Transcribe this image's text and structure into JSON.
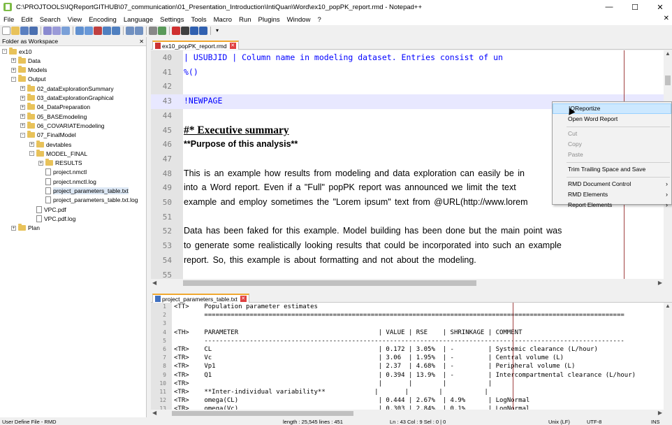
{
  "window": {
    "title": "C:\\PROJTOOLS\\IQReportGITHUB\\07_communication\\01_Presentation_Introduction\\IntiQuan\\Word\\ex10_popPK_report.rmd - Notepad++"
  },
  "menu": [
    "File",
    "Edit",
    "Search",
    "View",
    "Encoding",
    "Language",
    "Settings",
    "Tools",
    "Macro",
    "Run",
    "Plugins",
    "Window",
    "?"
  ],
  "left_panel": {
    "title": "Folder as Workspace",
    "tree": [
      {
        "label": "ex10",
        "icon": "folder-icon",
        "twist": "-"
      },
      {
        "label": "Data",
        "icon": "folder-icon",
        "twist": "+"
      },
      {
        "label": "Models",
        "icon": "folder-icon",
        "twist": "+"
      },
      {
        "label": "Output",
        "icon": "folder-icon",
        "twist": "-"
      },
      {
        "label": "02_dataExplorationSummary",
        "icon": "folder-icon",
        "twist": "+"
      },
      {
        "label": "03_dataExplorationGraphical",
        "icon": "folder-icon",
        "twist": "+"
      },
      {
        "label": "04_DataPreparation",
        "icon": "folder-icon",
        "twist": "+"
      },
      {
        "label": "05_BASEmodeling",
        "icon": "folder-icon",
        "twist": "+"
      },
      {
        "label": "06_COVARIATEmodeling",
        "icon": "folder-icon",
        "twist": "+"
      },
      {
        "label": "07_FinalModel",
        "icon": "folder-icon",
        "twist": "-"
      },
      {
        "label": "devtables",
        "icon": "folder-icon",
        "twist": "+"
      },
      {
        "label": "MODEL_FINAL",
        "icon": "folder-icon",
        "twist": "-"
      },
      {
        "label": "RESULTS",
        "icon": "folder-icon",
        "twist": "+"
      },
      {
        "label": "project.nmctl",
        "icon": "file-icon",
        "twist": ""
      },
      {
        "label": "project.nmctl.log",
        "icon": "file-icon",
        "twist": ""
      },
      {
        "label": "project_parameters_table.txt",
        "icon": "file-icon",
        "twist": ""
      },
      {
        "label": "project_parameters_table.txt.log",
        "icon": "file-icon",
        "twist": ""
      },
      {
        "label": "VPC.pdf",
        "icon": "file-icon",
        "twist": ""
      },
      {
        "label": "VPC.pdf.log",
        "icon": "file-icon",
        "twist": ""
      },
      {
        "label": "Plan",
        "icon": "folder-icon",
        "twist": "+"
      }
    ]
  },
  "editor1": {
    "tab": "ex10_popPK_report.rmd",
    "lines": [
      {
        "n": "40",
        "text": "| USUBJID                    | Column name in modeling dataset. Entries consist of un"
      },
      {
        "n": "41",
        "text": "%()"
      },
      {
        "n": "42",
        "text": ""
      },
      {
        "n": "43",
        "text": "!NEWPAGE"
      },
      {
        "n": "44",
        "text": ""
      },
      {
        "n": "45",
        "text": "#* Executive summary"
      },
      {
        "n": "46",
        "text": "**Purpose of this analysis**"
      },
      {
        "n": "47",
        "text": ""
      },
      {
        "n": "48",
        "text": "This is an example how results from modeling and data exploration can easily be in"
      },
      {
        "n": "49",
        "text": "into a Word report. Even if a \"Full\" popPK report was announced we limit the text"
      },
      {
        "n": "50",
        "text": "example and employ sometimes the \"Lorem ipsum\" text from @URL(http://www.lorem"
      },
      {
        "n": "51",
        "text": ""
      },
      {
        "n": "52",
        "text": "Data has been faked for this example. Model building has been done but the main point was"
      },
      {
        "n": "53",
        "text": "to generate some realistically looking results that could be incorporated into such an example"
      },
      {
        "n": "54",
        "text": "report. So, this example is about formatting and not about the modeling."
      },
      {
        "n": "55",
        "text": ""
      }
    ]
  },
  "editor2": {
    "tab": "project_parameters_table.txt",
    "lines": [
      {
        "n": "1",
        "text": "<TT>    Population parameter estimates"
      },
      {
        "n": "2",
        "text": "        ==============================================================================================================="
      },
      {
        "n": "3",
        "text": ""
      },
      {
        "n": "4",
        "text": "<TH>    PARAMETER                                     | VALUE | RSE    | SHRINKAGE | COMMENT"
      },
      {
        "n": "5",
        "text": "        ---------------------------------------------------------------------------------------------------------------"
      },
      {
        "n": "6",
        "text": "<TR>    CL                                            | 0.172 | 3.05%  | -         | Systemic clearance (L/hour)"
      },
      {
        "n": "7",
        "text": "<TR>    Vc                                            | 3.06  | 1.95%  | -         | Central volume (L)"
      },
      {
        "n": "8",
        "text": "<TR>    Vp1                                           | 2.37  | 4.68%  | -         | Peripheral volume (L)"
      },
      {
        "n": "9",
        "text": "<TR>    Q1                                            | 0.394 | 13.9%  | -         | Intercompartmental clearance (L/hour)"
      },
      {
        "n": "10",
        "text": "<TR>                                                  |       |        |           |"
      },
      {
        "n": "11",
        "text": "<TR>    **Inter-individual variability**             |       |        |           |"
      },
      {
        "n": "12",
        "text": "<TR>    omega(CL)                                     | 0.444 | 2.67%  | 4.9%      | LogNormal"
      },
      {
        "n": "13",
        "text": "<TR>    omega(Vc)                                     | 0.303 | 2.84%  | 0.1%      | LogNormal"
      }
    ]
  },
  "context_menu": {
    "items": [
      {
        "label": "IQReportize",
        "state": "highlighted",
        "sub": false
      },
      {
        "label": "Open Word Report",
        "state": "normal",
        "sub": false
      },
      {
        "label": "sep"
      },
      {
        "label": "Cut",
        "state": "disabled",
        "sub": false
      },
      {
        "label": "Copy",
        "state": "disabled",
        "sub": false
      },
      {
        "label": "Paste",
        "state": "disabled",
        "sub": false
      },
      {
        "label": "sep"
      },
      {
        "label": "Trim Trailing Space and Save",
        "state": "normal",
        "sub": false
      },
      {
        "label": "sep"
      },
      {
        "label": "RMD Document Control",
        "state": "normal",
        "sub": true
      },
      {
        "label": "RMD Elements",
        "state": "normal",
        "sub": true
      },
      {
        "label": "Report Elements",
        "state": "normal",
        "sub": true
      }
    ]
  },
  "statusbar": {
    "lang": "User Define File - RMD",
    "length": "length : 25,545    lines : 451",
    "pos": "Ln : 43    Col : 9    Sel : 0 | 0",
    "eol": "Unix (LF)",
    "enc": "UTF-8",
    "mode": "INS"
  },
  "colors": {
    "accent": "#f0a830",
    "menu_highlight": "#cce8ff",
    "edge_line": "#a04040"
  }
}
